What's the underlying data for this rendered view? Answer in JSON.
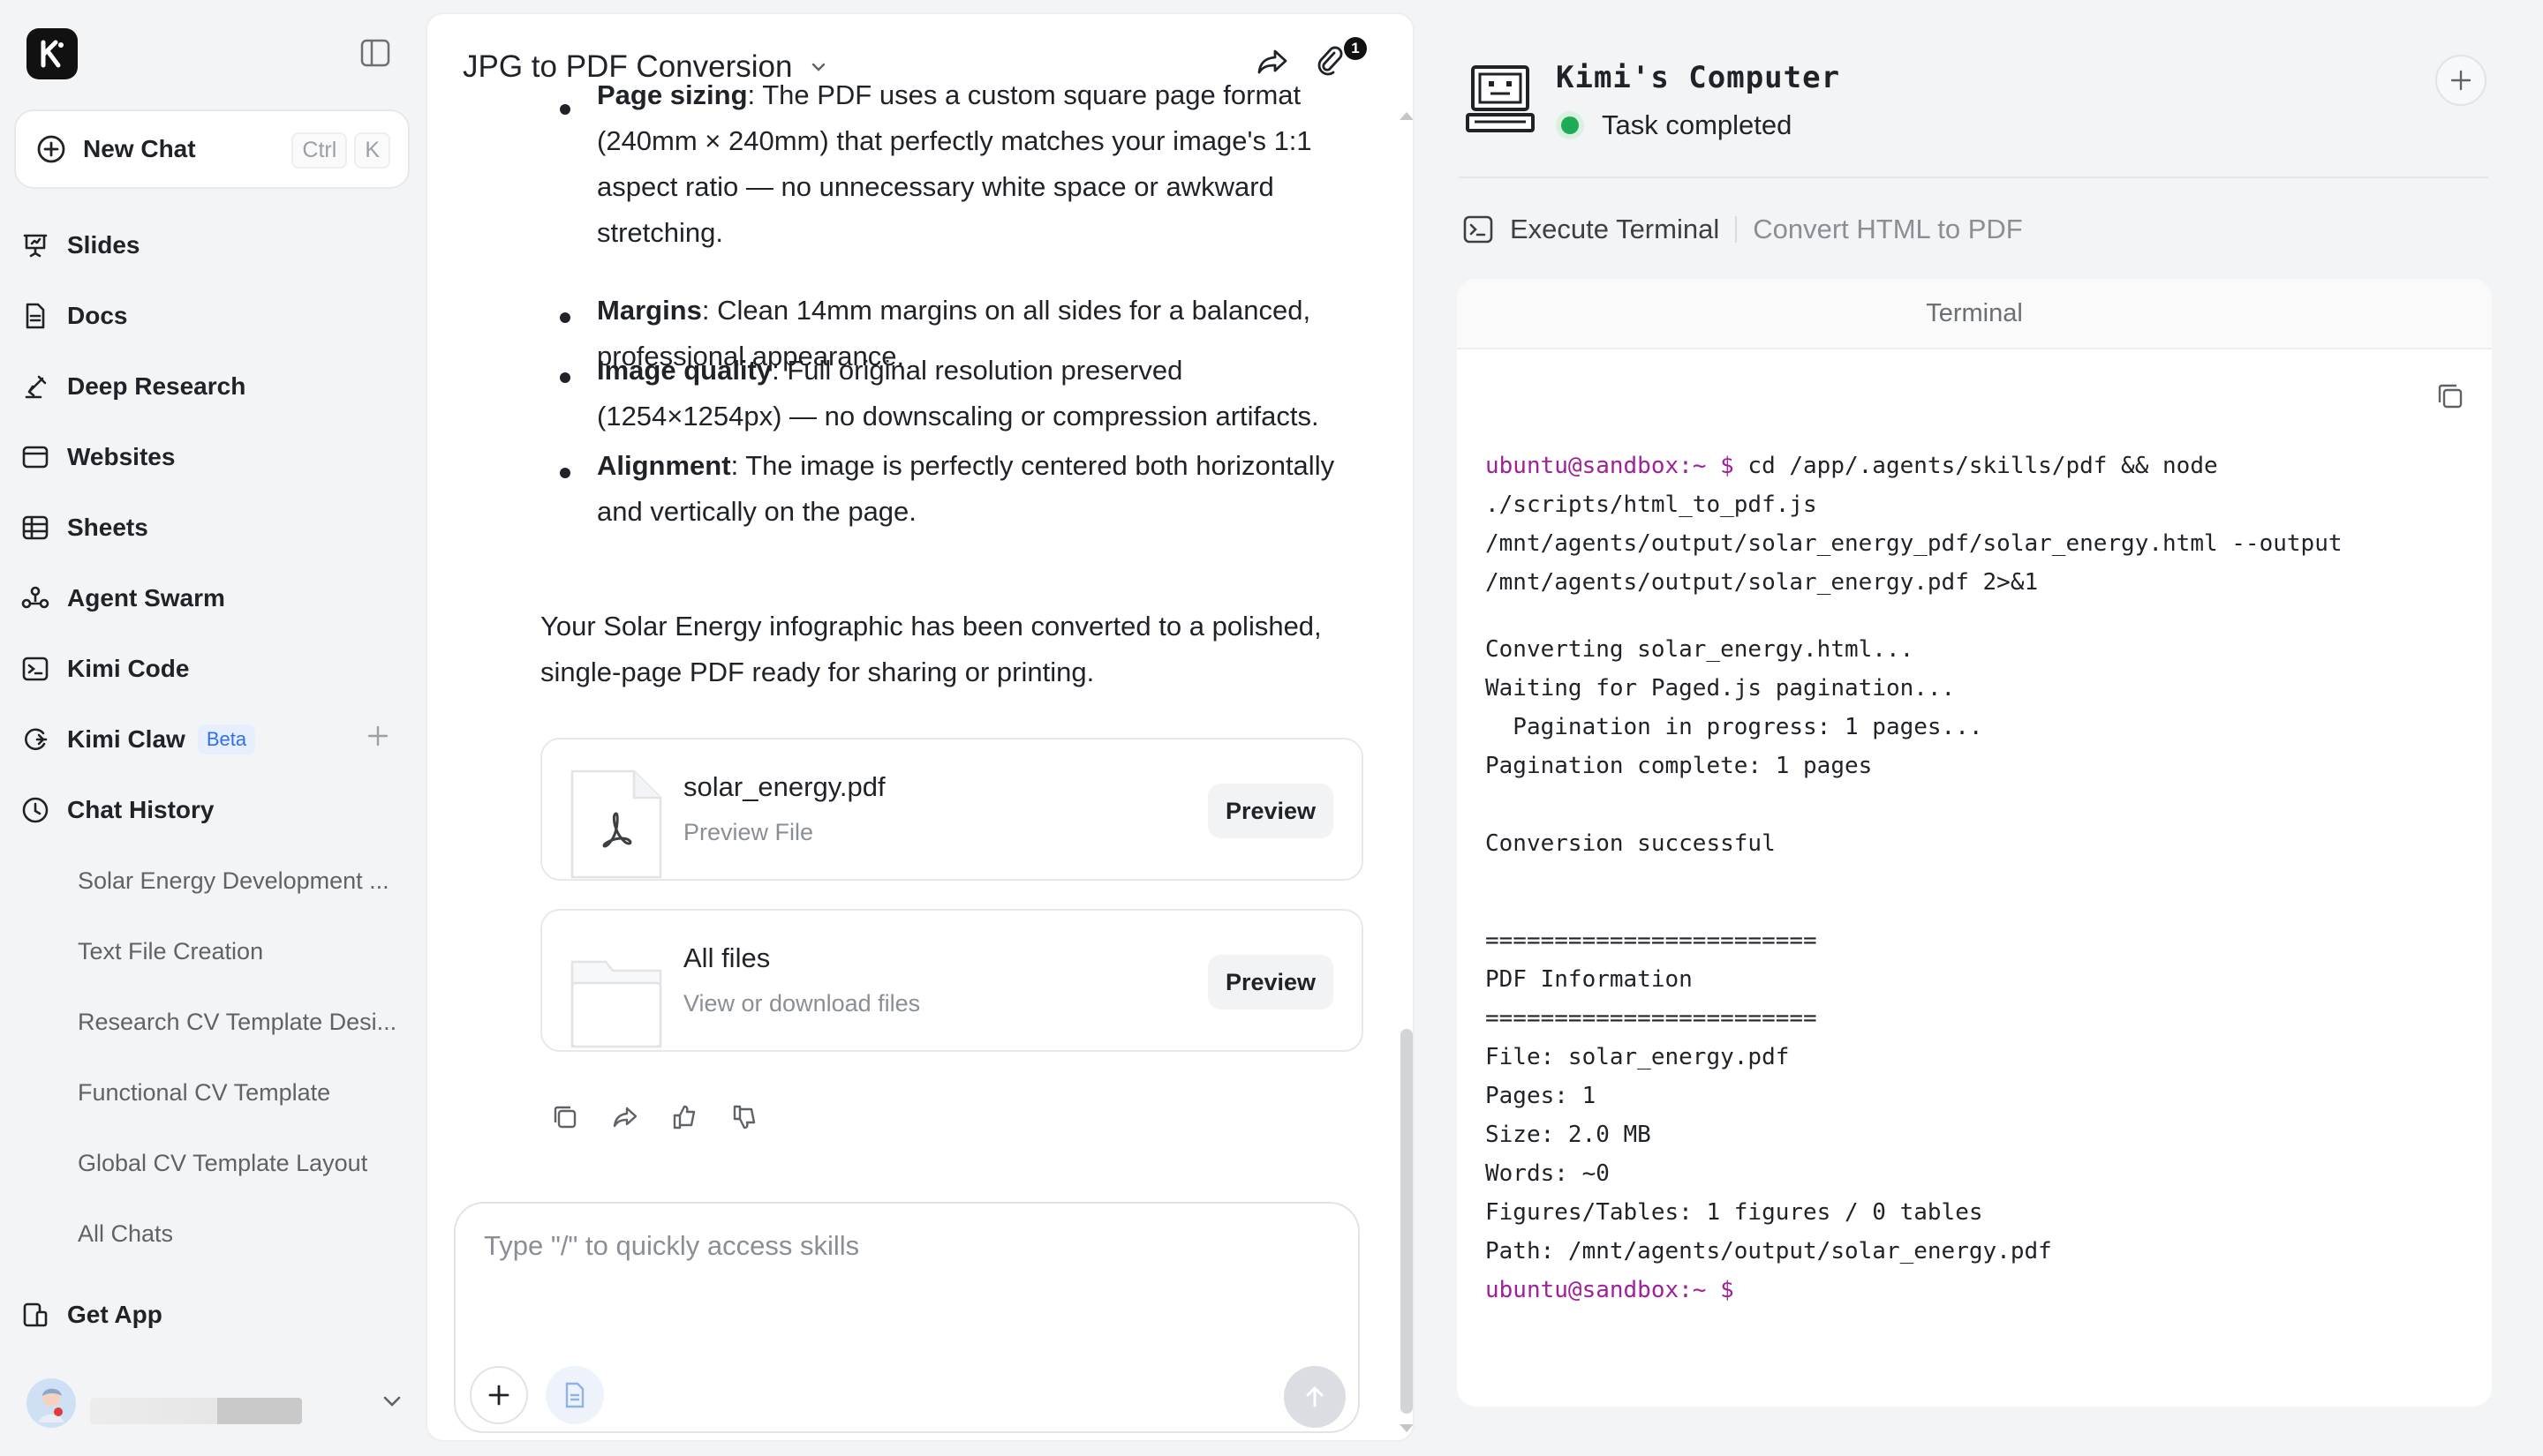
{
  "sidebar": {
    "new_chat_label": "New Chat",
    "shortcut_ctrl": "Ctrl",
    "shortcut_key": "K",
    "items": [
      {
        "label": "Slides"
      },
      {
        "label": "Docs"
      },
      {
        "label": "Deep Research"
      },
      {
        "label": "Websites"
      },
      {
        "label": "Sheets"
      },
      {
        "label": "Agent Swarm"
      },
      {
        "label": "Kimi Code"
      },
      {
        "label": "Kimi Claw",
        "badge": "Beta"
      },
      {
        "label": "Chat History"
      }
    ],
    "history": [
      "Solar Energy Development ...",
      "Text File Creation",
      "Research CV Template Desi...",
      "Functional CV Template",
      "Global CV Template Layout",
      "All Chats"
    ],
    "get_app_label": "Get App"
  },
  "chat": {
    "title": "JPG to PDF Conversion",
    "attach_count": "1",
    "bullets": [
      {
        "term": "Page sizing",
        "text": ": The PDF uses a custom square page format (240mm × 240mm) that perfectly matches your image's 1:1 aspect ratio — no unnecessary white space or awkward stretching."
      },
      {
        "term": "Margins",
        "text": ": Clean 14mm margins on all sides for a balanced, professional appearance."
      },
      {
        "term": "Image quality",
        "text": ": Full original resolution preserved (1254×1254px) — no downscaling or compression artifacts."
      },
      {
        "term": "Alignment",
        "text": ": The image is perfectly centered both horizontally and vertically on the page."
      }
    ],
    "summary": "Your Solar Energy infographic has been converted to a polished, single-page PDF ready for sharing or printing.",
    "files": [
      {
        "name": "solar_energy.pdf",
        "sub": "Preview File",
        "action": "Preview"
      },
      {
        "name": "All files",
        "sub": "View or download files",
        "action": "Preview"
      }
    ],
    "input_placeholder": "Type \"/\" to quickly access skills"
  },
  "computer": {
    "title": "Kimi's Computer",
    "status": "Task completed",
    "step_current": "Execute Terminal",
    "step_detail": "Convert HTML to PDF",
    "terminal_title": "Terminal",
    "prompt": "ubuntu@sandbox:~ $",
    "command_lines": [
      " cd /app/.agents/skills/pdf && node",
      "./scripts/html_to_pdf.js",
      "/mnt/agents/output/solar_energy_pdf/solar_energy.html --output",
      "/mnt/agents/output/solar_energy.pdf 2>&1"
    ],
    "output_1": [
      "Converting solar_energy.html...",
      "Waiting for Paged.js pagination...",
      "  Pagination in progress: 1 pages...",
      "Pagination complete: 1 pages"
    ],
    "output_2": "Conversion successful",
    "output_3": [
      "========================",
      "PDF Information",
      "========================",
      "File: solar_energy.pdf",
      "Pages: 1",
      "Size: 2.0 MB",
      "Words: ~0",
      "Figures/Tables: 1 figures / 0 tables",
      "Path: /mnt/agents/output/solar_energy.pdf"
    ]
  },
  "colors": {
    "prompt": "#a0209b",
    "status_green": "#1faa55",
    "beta_blue": "#2f6fed"
  }
}
